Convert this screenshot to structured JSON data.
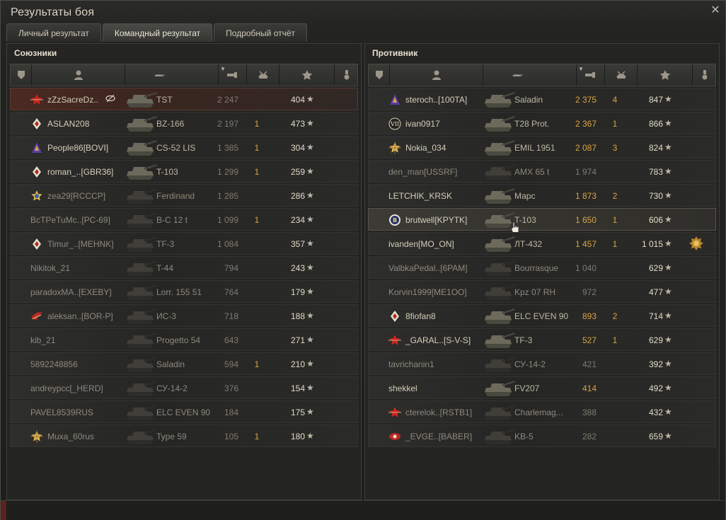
{
  "window": {
    "title": "Результаты боя"
  },
  "tabs": [
    {
      "label": "Личный результат",
      "active": false
    },
    {
      "label": "Командный результат",
      "active": true
    },
    {
      "label": "Подробный отчёт",
      "active": false
    }
  ],
  "allies": {
    "title": "Союзники",
    "rows": [
      {
        "player": "zZzSacreDz..",
        "clan_icon": "red-star-emblem-icon",
        "tank": "TST",
        "damage": "2 247",
        "damage_grey": true,
        "kills": "",
        "xp": "404",
        "highlight": "hl",
        "alive": true,
        "mark": true
      },
      {
        "player": "ASLAN208",
        "clan_icon": "diamond-emblem-icon",
        "tank": "BZ-166",
        "damage": "2 197",
        "damage_grey": true,
        "kills": "1",
        "xp": "473",
        "alive": true
      },
      {
        "player": "People86[BOVI]",
        "clan_icon": "purple-shield-emblem-icon",
        "tank": "CS-52 LIS",
        "damage": "1 385",
        "damage_grey": true,
        "kills": "1",
        "xp": "304",
        "alive": true
      },
      {
        "player": "roman_..[GBR36]",
        "clan_icon": "diamond-emblem-icon",
        "tank": "T-103",
        "damage": "1 299",
        "damage_grey": true,
        "kills": "1",
        "xp": "259",
        "alive": true
      },
      {
        "player": "zea29[RCCCP]",
        "clan_icon": "blue-star-emblem-icon",
        "tank": "Ferdinand",
        "damage": "1 285",
        "damage_grey": true,
        "kills": "",
        "xp": "286",
        "alive": false
      },
      {
        "player": "BcTPeTuMc..[PC-69]",
        "clan_icon": "",
        "tank": "B-C 12 t",
        "damage": "1 099",
        "damage_grey": true,
        "kills": "1",
        "xp": "234",
        "alive": false
      },
      {
        "player": "Timur_..[MEHNK]",
        "clan_icon": "diamond-emblem-icon",
        "tank": "TF-3",
        "damage": "1 084",
        "damage_grey": true,
        "kills": "",
        "xp": "357",
        "alive": false
      },
      {
        "player": "Nikitok_21",
        "clan_icon": "",
        "tank": "T-44",
        "damage": "794",
        "damage_grey": true,
        "kills": "",
        "xp": "243",
        "alive": false
      },
      {
        "player": "paradoxMA..[EXEBY]",
        "clan_icon": "",
        "tank": "Lorr. 155 51",
        "damage": "764",
        "damage_grey": true,
        "kills": "",
        "xp": "179",
        "alive": false
      },
      {
        "player": "aleksan..[BOR-P]",
        "clan_icon": "red-wing-emblem-icon",
        "tank": "ИС-3",
        "damage": "718",
        "damage_grey": true,
        "kills": "",
        "xp": "188",
        "alive": false
      },
      {
        "player": "kib_21",
        "clan_icon": "",
        "tank": "Progetto 54",
        "damage": "643",
        "damage_grey": true,
        "kills": "",
        "xp": "271",
        "alive": false
      },
      {
        "player": "5892248856",
        "clan_icon": "",
        "tank": "Saladin",
        "damage": "594",
        "damage_grey": true,
        "kills": "1",
        "xp": "210",
        "alive": false
      },
      {
        "player": "andreypcc[_HERD]",
        "clan_icon": "",
        "tank": "СУ-14-2",
        "damage": "376",
        "damage_grey": true,
        "kills": "",
        "xp": "154",
        "alive": false
      },
      {
        "player": "PAVEL8539RUS",
        "clan_icon": "",
        "tank": "ELC EVEN 90",
        "damage": "184",
        "damage_grey": true,
        "kills": "",
        "xp": "175",
        "alive": false
      },
      {
        "player": "Muxa_60rus",
        "clan_icon": "gold-star-emblem-icon",
        "tank": "Type 59",
        "damage": "105",
        "damage_grey": true,
        "kills": "1",
        "xp": "180",
        "alive": false
      }
    ]
  },
  "enemies": {
    "title": "Противник",
    "rows": [
      {
        "player": "steroch..[100TA]",
        "clan_icon": "purple-shield-emblem-icon",
        "tank": "Saladin",
        "damage": "2 375",
        "damage_grey": false,
        "kills": "4",
        "xp": "847",
        "alive": true
      },
      {
        "player": "ivan0917",
        "clan_icon": "roman-seven-emblem-icon",
        "tank": "T28 Prot.",
        "damage": "2 367",
        "damage_grey": false,
        "kills": "1",
        "xp": "866",
        "alive": true
      },
      {
        "player": "Nokia_034",
        "clan_icon": "gold-star-emblem-icon",
        "tank": "EMIL 1951",
        "damage": "2 087",
        "damage_grey": false,
        "kills": "3",
        "xp": "824",
        "alive": true
      },
      {
        "player": "den_man[USSRF]",
        "clan_icon": "",
        "tank": "AMX 65 t",
        "damage": "1 974",
        "damage_grey": true,
        "kills": "",
        "xp": "783",
        "alive": false
      },
      {
        "player": "LETCHIK_KRSK",
        "clan_icon": "",
        "tank": "Марс",
        "damage": "1 873",
        "damage_grey": false,
        "kills": "2",
        "xp": "730",
        "alive": true
      },
      {
        "player": "brutwell[KPYTK]",
        "clan_icon": "b-circle-emblem-icon",
        "tank": "T-103",
        "damage": "1 650",
        "damage_grey": false,
        "kills": "1",
        "xp": "606",
        "alive": true,
        "highlight": "self",
        "cursor": true
      },
      {
        "player": "ivanden[MO_ON]",
        "clan_icon": "",
        "tank": "ЛТ-432",
        "damage": "1 457",
        "damage_grey": false,
        "kills": "1",
        "xp": "1 015",
        "alive": true,
        "medal": true
      },
      {
        "player": "ValbkaPedal..[6PAM]",
        "clan_icon": "",
        "tank": "Bourrasque",
        "damage": "1 040",
        "damage_grey": true,
        "kills": "",
        "xp": "629",
        "alive": false
      },
      {
        "player": "Korvin1999[ME1OO]",
        "clan_icon": "",
        "tank": "Kpz 07 RH",
        "damage": "972",
        "damage_grey": true,
        "kills": "",
        "xp": "477",
        "alive": false
      },
      {
        "player": "8fiofan8",
        "clan_icon": "diamond-emblem-icon",
        "tank": "ELC EVEN 90",
        "damage": "893",
        "damage_grey": false,
        "kills": "2",
        "xp": "714",
        "alive": true
      },
      {
        "player": "_GARAL..[S-V-S]",
        "clan_icon": "red-star-emblem-icon",
        "tank": "TF-3",
        "damage": "527",
        "damage_grey": false,
        "kills": "1",
        "xp": "629",
        "alive": true
      },
      {
        "player": "tavrichanin1",
        "clan_icon": "",
        "tank": "СУ-14-2",
        "damage": "421",
        "damage_grey": true,
        "kills": "",
        "xp": "392",
        "alive": false
      },
      {
        "player": "shekkel",
        "clan_icon": "",
        "tank": "FV207",
        "damage": "414",
        "damage_grey": false,
        "kills": "",
        "xp": "492",
        "alive": true
      },
      {
        "player": "cterelok..[RSTB1]",
        "clan_icon": "red-star-emblem-icon",
        "tank": "Charlemag...",
        "damage": "388",
        "damage_grey": true,
        "kills": "",
        "xp": "432",
        "alive": false
      },
      {
        "player": "_EVGE..[BABER]",
        "clan_icon": "red-eye-emblem-icon",
        "tank": "KB-5",
        "damage": "282",
        "damage_grey": true,
        "kills": "",
        "xp": "659",
        "alive": false
      }
    ]
  },
  "colors": {
    "damage": "#d9a441",
    "highlight_row": "#4a2a22",
    "accent": "#d9a441"
  }
}
